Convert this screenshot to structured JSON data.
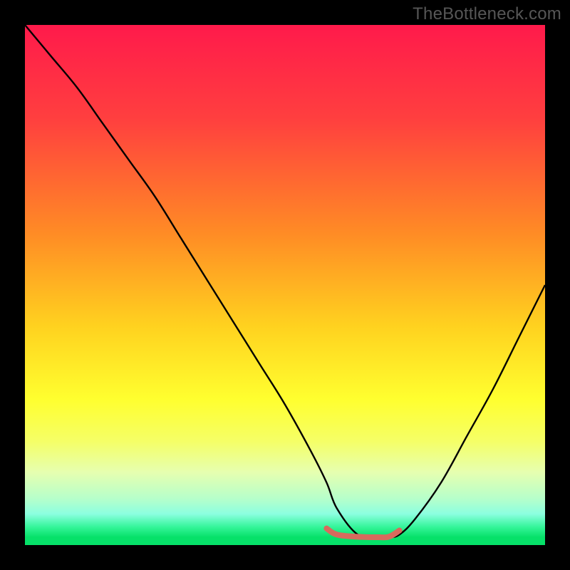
{
  "watermark": "TheBottleneck.com",
  "chart_data": {
    "type": "line",
    "title": "",
    "xlabel": "",
    "ylabel": "",
    "x_range": [
      0,
      100
    ],
    "y_range": [
      0,
      100
    ],
    "legend": false,
    "annotations": [],
    "gradient_stops": [
      {
        "offset": 0.0,
        "color": "#ff1a4b"
      },
      {
        "offset": 0.18,
        "color": "#ff3f3f"
      },
      {
        "offset": 0.4,
        "color": "#ff8b25"
      },
      {
        "offset": 0.58,
        "color": "#ffd21f"
      },
      {
        "offset": 0.72,
        "color": "#ffff2f"
      },
      {
        "offset": 0.8,
        "color": "#f5ff66"
      },
      {
        "offset": 0.86,
        "color": "#e6ffb0"
      },
      {
        "offset": 0.91,
        "color": "#b7ffca"
      },
      {
        "offset": 0.94,
        "color": "#8cffe0"
      },
      {
        "offset": 0.965,
        "color": "#35f59a"
      },
      {
        "offset": 0.985,
        "color": "#06e169"
      },
      {
        "offset": 1.0,
        "color": "#06e169"
      }
    ],
    "series": [
      {
        "name": "bottleneck-curve",
        "color": "#000000",
        "width": 2.4,
        "x": [
          0,
          5,
          10,
          15,
          20,
          25,
          30,
          35,
          40,
          45,
          50,
          55,
          58,
          60,
          64,
          68,
          70,
          72,
          75,
          80,
          85,
          90,
          95,
          100
        ],
        "y": [
          100,
          94,
          88,
          81,
          74,
          67,
          59,
          51,
          43,
          35,
          27,
          18,
          12,
          7,
          2,
          1.5,
          1.5,
          2,
          5,
          12,
          21,
          30,
          40,
          50
        ]
      },
      {
        "name": "floor-highlight",
        "color": "#d86a5d",
        "width": 8,
        "linecap": "round",
        "x": [
          58,
          60,
          64,
          68,
          70,
          72
        ],
        "y": [
          3.2,
          2.0,
          1.6,
          1.5,
          1.6,
          2.8
        ]
      }
    ]
  }
}
